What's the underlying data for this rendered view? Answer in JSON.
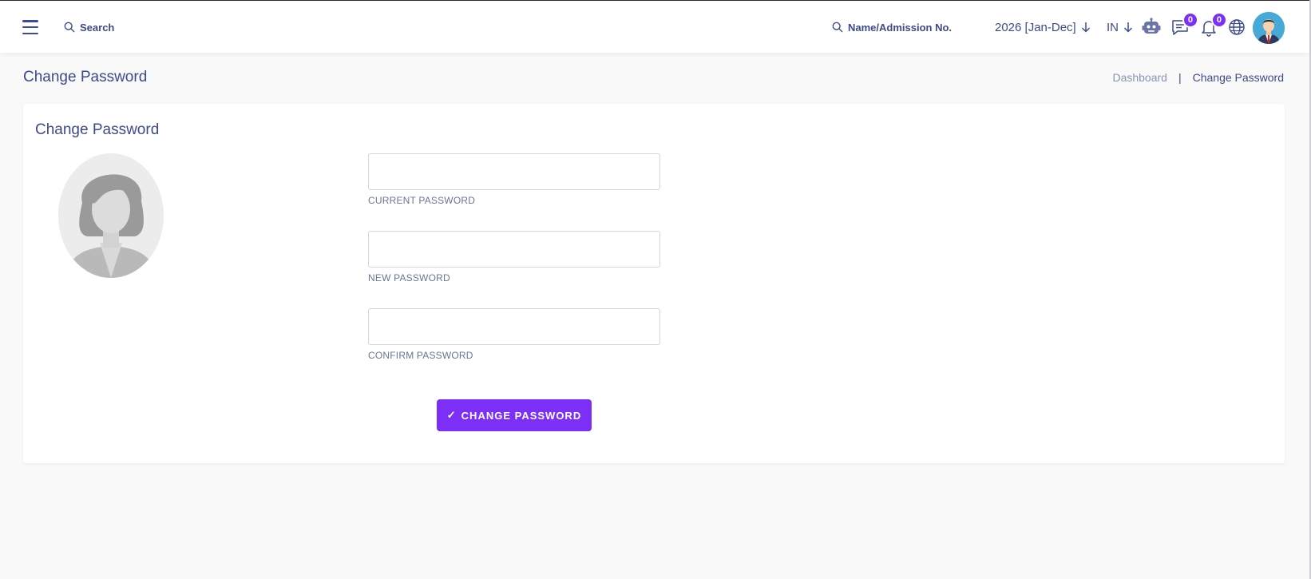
{
  "header": {
    "search_label": "Search",
    "student_search_placeholder": "Name/Admission No.",
    "session_label": "2026 [Jan-Dec]",
    "language_label": "IN",
    "chat_count": "0",
    "notification_count": "0"
  },
  "page": {
    "title": "Change Password",
    "breadcrumb": {
      "home": "Dashboard",
      "separator": "|",
      "current": "Change Password"
    }
  },
  "form": {
    "card_title": "Change Password",
    "current_password_label": "CURRENT PASSWORD",
    "new_password_label": "NEW PASSWORD",
    "confirm_password_label": "CONFIRM PASSWORD",
    "submit_label": "CHANGE PASSWORD",
    "submit_icon": "✓"
  },
  "colors": {
    "accent": "#7b2ff7",
    "text_primary": "#3d4a8a",
    "background": "#f9f9f9"
  },
  "icons": [
    "menu-icon",
    "search-icon",
    "chevron-down-icon",
    "robot-icon",
    "chat-icon",
    "bell-icon",
    "globe-icon",
    "user-avatar",
    "profile-placeholder"
  ]
}
